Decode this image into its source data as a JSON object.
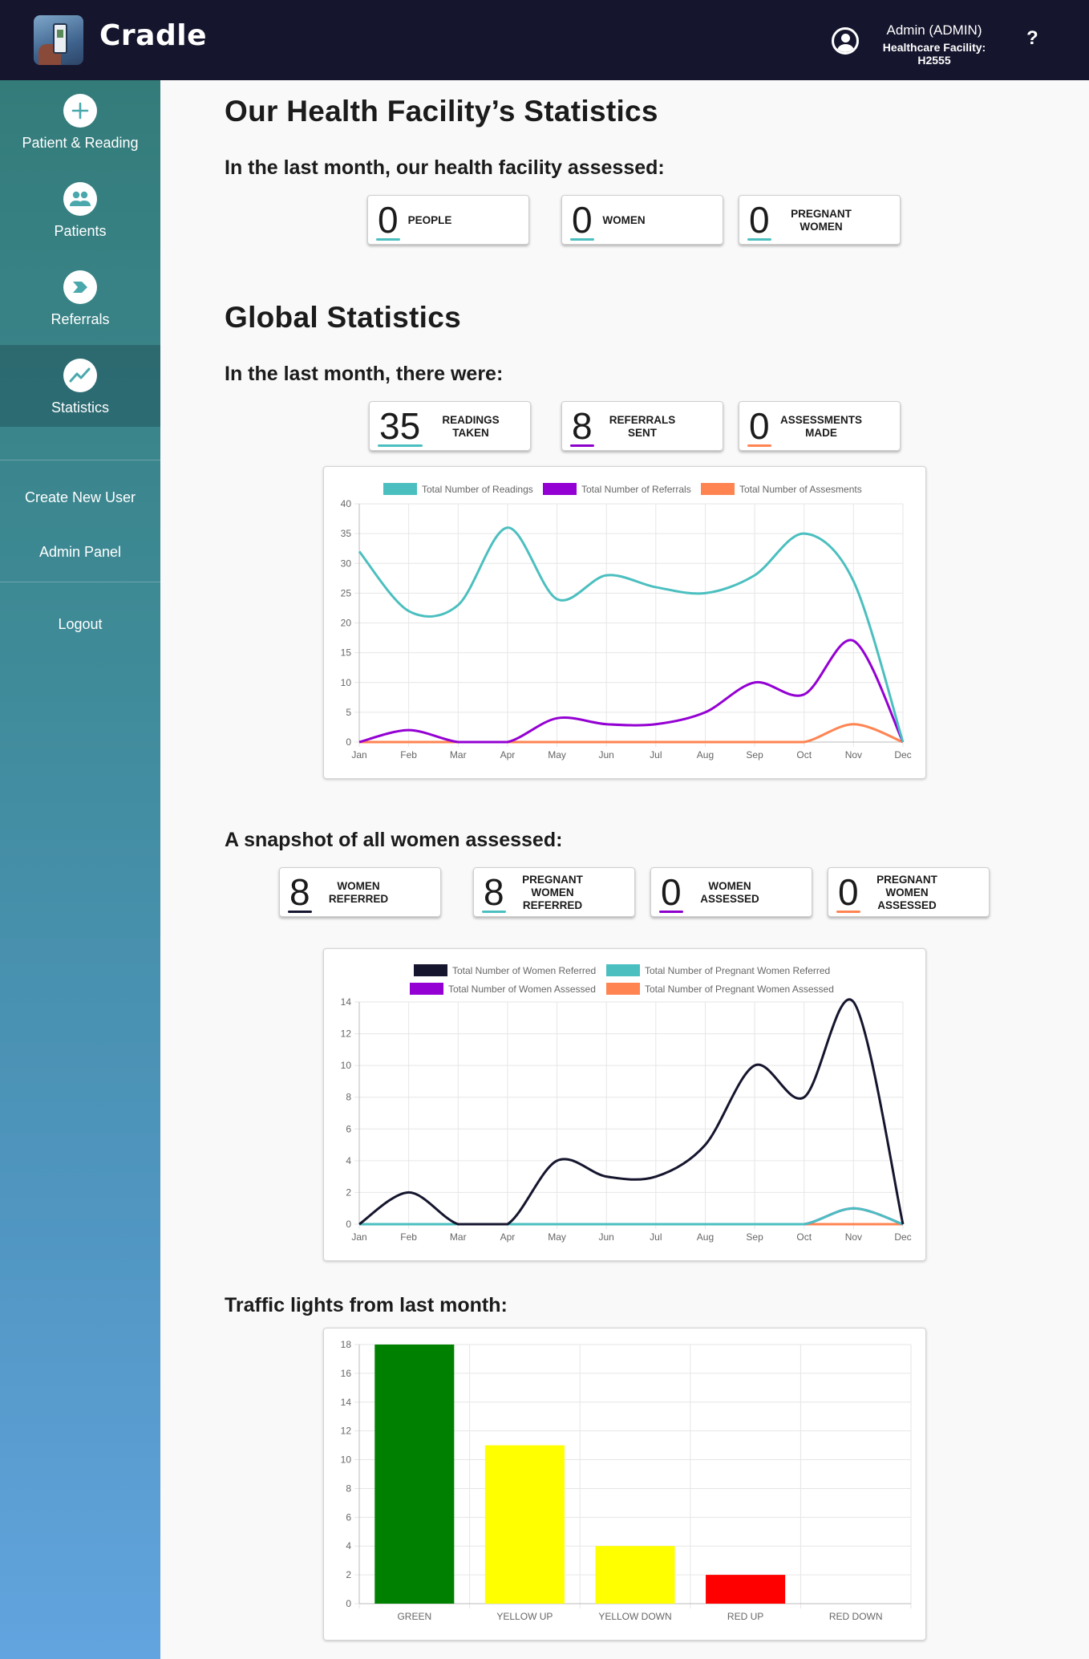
{
  "header": {
    "brand": "Cradle",
    "user_name": "Admin (ADMIN)",
    "facility": "Healthcare Facility: H2555",
    "help": "?"
  },
  "sidebar": {
    "items": [
      {
        "label": "Patient & Reading",
        "icon": "plus-icon"
      },
      {
        "label": "Patients",
        "icon": "people-icon"
      },
      {
        "label": "Referrals",
        "icon": "send-icon"
      },
      {
        "label": "Statistics",
        "icon": "chart-line-icon",
        "active": true
      }
    ],
    "links": [
      "Create New User",
      "Admin Panel",
      "Logout"
    ]
  },
  "facility": {
    "title": "Our Health Facility’s Statistics",
    "subtitle": "In the last month, our health facility assessed:",
    "stats": [
      {
        "value": "0",
        "label": "PEOPLE",
        "color": "#4bbfbf"
      },
      {
        "value": "0",
        "label": "WOMEN",
        "color": "#4bbfbf"
      },
      {
        "value": "0",
        "label": "PREGNANT WOMEN",
        "color": "#4bbfbf"
      }
    ]
  },
  "global": {
    "title": "Global Statistics",
    "subtitle": "In the last month, there were:",
    "stats": [
      {
        "value": "35",
        "label": "READINGS TAKEN",
        "color": "#4bbfbf"
      },
      {
        "value": "8",
        "label": "REFERRALS SENT",
        "color": "#8c00cc"
      },
      {
        "value": "0",
        "label": "ASSESSMENTS MADE",
        "color": "#ff8452"
      }
    ]
  },
  "snapshot": {
    "title": "A snapshot of all women assessed:",
    "stats": [
      {
        "value": "8",
        "label": "WOMEN REFERRED",
        "color": "#15152e"
      },
      {
        "value": "8",
        "label": "PREGNANT WOMEN REFERRED",
        "color": "#4bbfbf"
      },
      {
        "value": "0",
        "label": "WOMEN ASSESSED",
        "color": "#8c00cc"
      },
      {
        "value": "0",
        "label": "PREGNANT WOMEN ASSESSED",
        "color": "#ff8452"
      }
    ]
  },
  "traffic": {
    "title": "Traffic lights from last month:"
  },
  "chart_data": [
    {
      "type": "line",
      "categories": [
        "Jan",
        "Feb",
        "Mar",
        "Apr",
        "May",
        "Jun",
        "Jul",
        "Aug",
        "Sep",
        "Oct",
        "Nov",
        "Dec"
      ],
      "ylim": [
        0,
        40
      ],
      "yticks": [
        0,
        5,
        10,
        15,
        20,
        25,
        30,
        35,
        40
      ],
      "grid": true,
      "legend": "top",
      "series": [
        {
          "name": "Total Number of Readings",
          "color": "#4bbfbf",
          "values": [
            32,
            22,
            23,
            36,
            24,
            28,
            26,
            25,
            28,
            35,
            27,
            0
          ]
        },
        {
          "name": "Total Number of Referrals",
          "color": "#9400d3",
          "values": [
            0,
            2,
            0,
            0,
            4,
            3,
            3,
            5,
            10,
            8,
            17,
            0
          ]
        },
        {
          "name": "Total Number of Assesments",
          "color": "#ff8452",
          "values": [
            0,
            0,
            0,
            0,
            0,
            0,
            0,
            0,
            0,
            0,
            3,
            0
          ]
        }
      ]
    },
    {
      "type": "line",
      "categories": [
        "Jan",
        "Feb",
        "Mar",
        "Apr",
        "May",
        "Jun",
        "Jul",
        "Aug",
        "Sep",
        "Oct",
        "Nov",
        "Dec"
      ],
      "ylim": [
        0,
        14
      ],
      "yticks": [
        0,
        2,
        4,
        6,
        8,
        10,
        12,
        14
      ],
      "grid": true,
      "legend": "top",
      "series": [
        {
          "name": "Total Number of Women Referred",
          "color": "#15152e",
          "values": [
            0,
            2,
            0,
            0,
            4,
            3,
            3,
            5,
            10,
            8,
            14,
            0
          ]
        },
        {
          "name": "Total Number of Pregnant Women Referred",
          "color": "#4bbfbf",
          "values": [
            0,
            0,
            0,
            0,
            0,
            0,
            0,
            0,
            0,
            0,
            1,
            0
          ]
        },
        {
          "name": "Total Number of Women Assessed",
          "color": "#9400d3",
          "values": [
            0,
            0,
            0,
            0,
            0,
            0,
            0,
            0,
            0,
            0,
            1,
            0
          ]
        },
        {
          "name": "Total Number of Pregnant Women Assessed",
          "color": "#ff8452",
          "values": [
            0,
            0,
            0,
            0,
            0,
            0,
            0,
            0,
            0,
            0,
            0,
            0
          ]
        }
      ]
    },
    {
      "type": "bar",
      "categories": [
        "GREEN",
        "YELLOW UP",
        "YELLOW DOWN",
        "RED UP",
        "RED DOWN"
      ],
      "values": [
        18,
        11,
        4,
        2,
        0
      ],
      "colors": [
        "#008000",
        "#ffff00",
        "#ffff00",
        "#ff0000",
        "#ff0000"
      ],
      "ylim": [
        0,
        18
      ],
      "yticks": [
        0,
        2,
        4,
        6,
        8,
        10,
        12,
        14,
        16,
        18
      ],
      "grid": true
    }
  ]
}
